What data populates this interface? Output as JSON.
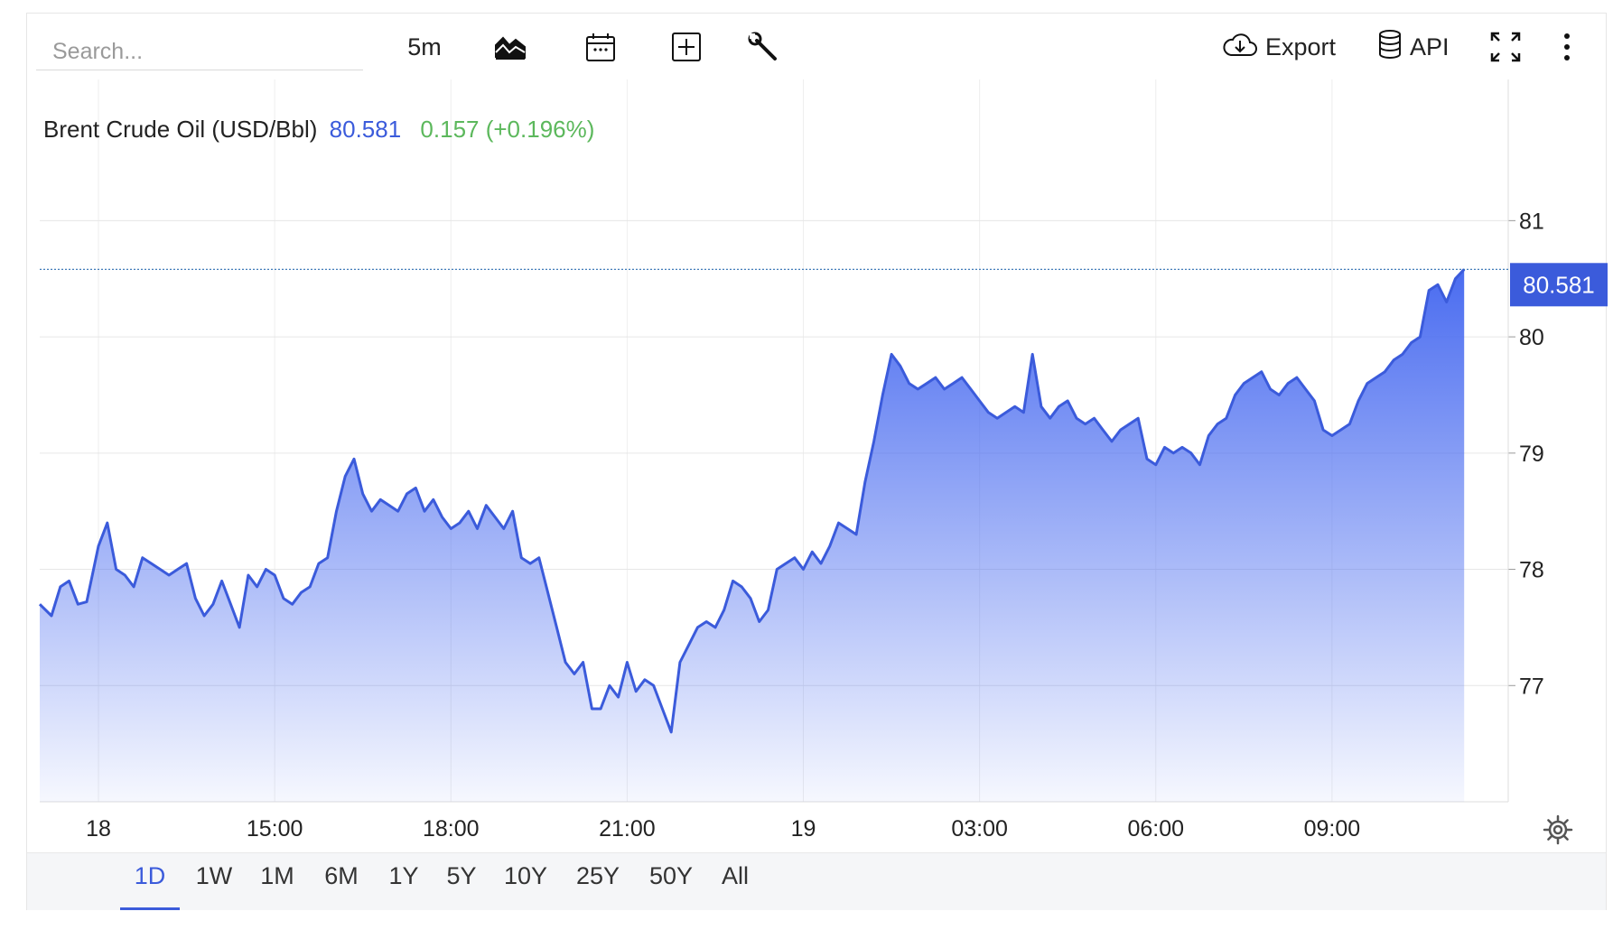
{
  "toolbar": {
    "search_placeholder": "Search...",
    "interval_label": "5m",
    "export_label": "Export",
    "api_label": "API",
    "icons": [
      "chart-type-icon",
      "calendar-icon",
      "add-indicator-icon",
      "wrench-icon",
      "cloud-download-icon",
      "database-icon",
      "fullscreen-icon",
      "more-vertical-icon"
    ]
  },
  "legend": {
    "symbol": "Brent Crude Oil (USD/Bbl)",
    "last": "80.581",
    "change": "0.157 (+0.196%)"
  },
  "range": {
    "buttons": [
      "1D",
      "1W",
      "1M",
      "6M",
      "1Y",
      "5Y",
      "10Y",
      "25Y",
      "50Y",
      "All"
    ],
    "active": "1D"
  },
  "colors": {
    "line": "#3b5bdb",
    "fill_top": "#4a6cf0",
    "change_positive": "#5cb85c",
    "price_label_bg": "#3b5bdb"
  },
  "chart_data": {
    "type": "area",
    "title": "",
    "xlabel": "",
    "ylabel": "",
    "x_ticks": [
      "18",
      "15:00",
      "18:00",
      "21:00",
      "19",
      "03:00",
      "06:00",
      "09:00"
    ],
    "y_ticks": [
      77,
      78,
      79,
      80,
      81
    ],
    "ylim": [
      76.0,
      81.5
    ],
    "grid": true,
    "last_price": 80.581,
    "last_price_label": "80.581",
    "x_unit": "hours relative to 00:00 on the 18th",
    "series": [
      {
        "values": [
          [
            -1.0,
            77.7
          ],
          [
            -0.8,
            77.6
          ],
          [
            -0.65,
            77.85
          ],
          [
            -0.5,
            77.9
          ],
          [
            -0.35,
            77.7
          ],
          [
            -0.2,
            77.72
          ],
          [
            0.0,
            78.2
          ],
          [
            0.15,
            78.4
          ],
          [
            0.3,
            78.0
          ],
          [
            0.45,
            77.95
          ],
          [
            0.6,
            77.85
          ],
          [
            0.75,
            78.1
          ],
          [
            0.9,
            78.05
          ],
          [
            1.05,
            78.0
          ],
          [
            1.2,
            77.95
          ],
          [
            1.35,
            78.0
          ],
          [
            1.5,
            78.05
          ],
          [
            1.65,
            77.75
          ],
          [
            1.8,
            77.6
          ],
          [
            1.95,
            77.7
          ],
          [
            2.1,
            77.9
          ],
          [
            2.25,
            77.7
          ],
          [
            2.4,
            77.5
          ],
          [
            2.55,
            77.95
          ],
          [
            2.7,
            77.85
          ],
          [
            2.85,
            78.0
          ],
          [
            3.0,
            77.95
          ],
          [
            3.15,
            77.75
          ],
          [
            3.3,
            77.7
          ],
          [
            3.45,
            77.8
          ],
          [
            3.6,
            77.85
          ],
          [
            3.75,
            78.05
          ],
          [
            3.9,
            78.1
          ],
          [
            4.05,
            78.5
          ],
          [
            4.2,
            78.8
          ],
          [
            4.35,
            78.95
          ],
          [
            4.5,
            78.65
          ],
          [
            4.65,
            78.5
          ],
          [
            4.8,
            78.6
          ],
          [
            4.95,
            78.55
          ],
          [
            5.1,
            78.5
          ],
          [
            5.25,
            78.65
          ],
          [
            5.4,
            78.7
          ],
          [
            5.55,
            78.5
          ],
          [
            5.7,
            78.6
          ],
          [
            5.85,
            78.45
          ],
          [
            6.0,
            78.35
          ],
          [
            6.15,
            78.4
          ],
          [
            6.3,
            78.5
          ],
          [
            6.45,
            78.35
          ],
          [
            6.6,
            78.55
          ],
          [
            6.75,
            78.45
          ],
          [
            6.9,
            78.35
          ],
          [
            7.05,
            78.5
          ],
          [
            7.2,
            78.1
          ],
          [
            7.35,
            78.05
          ],
          [
            7.5,
            78.1
          ],
          [
            7.65,
            77.8
          ],
          [
            7.8,
            77.5
          ],
          [
            7.95,
            77.2
          ],
          [
            8.1,
            77.1
          ],
          [
            8.25,
            77.2
          ],
          [
            8.4,
            76.8
          ],
          [
            8.55,
            76.8
          ],
          [
            8.7,
            77.0
          ],
          [
            8.85,
            76.9
          ],
          [
            9.0,
            77.2
          ],
          [
            9.15,
            76.95
          ],
          [
            9.3,
            77.05
          ],
          [
            9.45,
            77.0
          ],
          [
            9.6,
            76.8
          ],
          [
            9.75,
            76.6
          ],
          [
            9.9,
            77.2
          ],
          [
            10.05,
            77.35
          ],
          [
            10.2,
            77.5
          ],
          [
            10.35,
            77.55
          ],
          [
            10.5,
            77.5
          ],
          [
            10.65,
            77.65
          ],
          [
            10.8,
            77.9
          ],
          [
            10.95,
            77.85
          ],
          [
            11.1,
            77.75
          ],
          [
            11.25,
            77.55
          ],
          [
            11.4,
            77.65
          ],
          [
            11.55,
            78.0
          ],
          [
            11.7,
            78.05
          ],
          [
            11.85,
            78.1
          ],
          [
            12.0,
            78.0
          ],
          [
            12.15,
            78.15
          ],
          [
            12.3,
            78.05
          ],
          [
            12.45,
            78.2
          ],
          [
            12.6,
            78.4
          ],
          [
            12.75,
            78.35
          ],
          [
            12.9,
            78.3
          ],
          [
            13.05,
            78.75
          ],
          [
            13.2,
            79.1
          ],
          [
            13.35,
            79.5
          ],
          [
            13.5,
            79.85
          ],
          [
            13.65,
            79.75
          ],
          [
            13.8,
            79.6
          ],
          [
            13.95,
            79.55
          ],
          [
            14.1,
            79.6
          ],
          [
            14.25,
            79.65
          ],
          [
            14.4,
            79.55
          ],
          [
            14.55,
            79.6
          ],
          [
            14.7,
            79.65
          ],
          [
            14.85,
            79.55
          ],
          [
            15.0,
            79.45
          ],
          [
            15.15,
            79.35
          ],
          [
            15.3,
            79.3
          ],
          [
            15.45,
            79.35
          ],
          [
            15.6,
            79.4
          ],
          [
            15.75,
            79.35
          ],
          [
            15.9,
            79.85
          ],
          [
            16.05,
            79.4
          ],
          [
            16.2,
            79.3
          ],
          [
            16.35,
            79.4
          ],
          [
            16.5,
            79.45
          ],
          [
            16.65,
            79.3
          ],
          [
            16.8,
            79.25
          ],
          [
            16.95,
            79.3
          ],
          [
            17.1,
            79.2
          ],
          [
            17.25,
            79.1
          ],
          [
            17.4,
            79.2
          ],
          [
            17.55,
            79.25
          ],
          [
            17.7,
            79.3
          ],
          [
            17.85,
            78.95
          ],
          [
            18.0,
            78.9
          ],
          [
            18.15,
            79.05
          ],
          [
            18.3,
            79.0
          ],
          [
            18.45,
            79.05
          ],
          [
            18.6,
            79.0
          ],
          [
            18.75,
            78.9
          ],
          [
            18.9,
            79.15
          ],
          [
            19.05,
            79.25
          ],
          [
            19.2,
            79.3
          ],
          [
            19.35,
            79.5
          ],
          [
            19.5,
            79.6
          ],
          [
            19.65,
            79.65
          ],
          [
            19.8,
            79.7
          ],
          [
            19.95,
            79.55
          ],
          [
            20.1,
            79.5
          ],
          [
            20.25,
            79.6
          ],
          [
            20.4,
            79.65
          ],
          [
            20.55,
            79.55
          ],
          [
            20.7,
            79.45
          ],
          [
            20.85,
            79.2
          ],
          [
            21.0,
            79.15
          ],
          [
            21.15,
            79.2
          ],
          [
            21.3,
            79.25
          ],
          [
            21.45,
            79.45
          ],
          [
            21.6,
            79.6
          ],
          [
            21.75,
            79.65
          ],
          [
            21.9,
            79.7
          ],
          [
            22.05,
            79.8
          ],
          [
            22.2,
            79.85
          ],
          [
            22.35,
            79.95
          ],
          [
            22.5,
            80.0
          ],
          [
            22.65,
            80.4
          ],
          [
            22.8,
            80.45
          ],
          [
            22.95,
            80.3
          ],
          [
            23.1,
            80.5
          ],
          [
            23.25,
            80.581
          ]
        ]
      }
    ]
  }
}
